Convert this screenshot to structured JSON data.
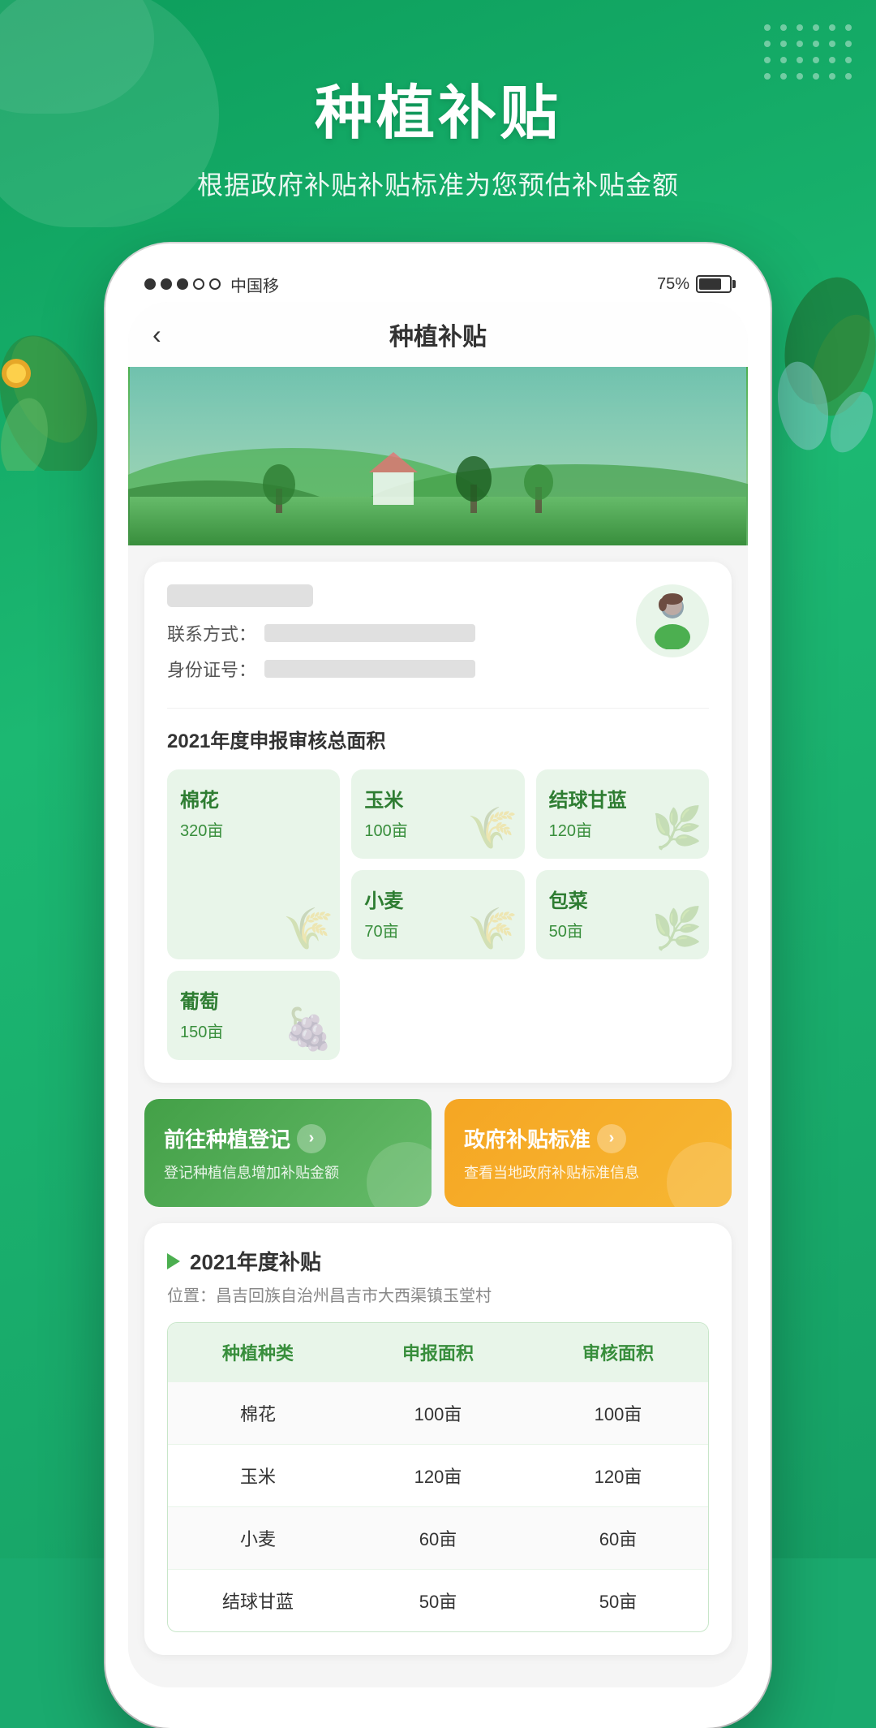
{
  "background": {
    "color": "#1aaa6e"
  },
  "header": {
    "title": "种植补贴",
    "subtitle": "根据政府补贴补贴标准为您预估补贴金额"
  },
  "statusBar": {
    "carrier": "中国移",
    "battery": "75%"
  },
  "navbar": {
    "back": "‹",
    "title": "种植补贴"
  },
  "userCard": {
    "nameBlurred": true,
    "contactLabel": "联系方式：",
    "idLabel": "身份证号："
  },
  "areaSection": {
    "title": "2021年度申报审核总面积",
    "crops": [
      {
        "name": "棉花",
        "area": "320亩",
        "large": true
      },
      {
        "name": "玉米",
        "area": "100亩",
        "large": false
      },
      {
        "name": "结球甘蓝",
        "area": "120亩",
        "large": false
      },
      {
        "name": "小麦",
        "area": "70亩",
        "large": false
      },
      {
        "name": "包菜",
        "area": "50亩",
        "large": false
      },
      {
        "name": "葡萄",
        "area": "150亩",
        "large": false
      }
    ]
  },
  "actionButtons": [
    {
      "title": "前往种植登记",
      "subtitle": "登记种植信息增加补贴金额",
      "type": "green",
      "arrow": "›"
    },
    {
      "title": "政府补贴标准",
      "subtitle": "查看当地政府补贴标准信息",
      "type": "orange",
      "arrow": "›"
    }
  ],
  "subsidySection": {
    "title": "2021年度补贴",
    "location": "位置：昌吉回族自治州昌吉市大西渠镇玉堂村",
    "tableHeaders": [
      "种植种类",
      "申报面积",
      "审核面积"
    ],
    "tableRows": [
      {
        "type": "棉花",
        "declared": "100亩",
        "approved": "100亩"
      },
      {
        "type": "玉米",
        "declared": "120亩",
        "approved": "120亩"
      },
      {
        "type": "小麦",
        "declared": "60亩",
        "approved": "60亩"
      },
      {
        "type": "结球甘蓝",
        "declared": "50亩",
        "approved": "50亩"
      }
    ]
  },
  "icons": {
    "leaf": "🌿",
    "wheat": "🌾",
    "grape": "🍇",
    "back_arrow": "‹",
    "circle_arrow": "›"
  },
  "dotGrid": {
    "rows": 4,
    "cols": 6
  }
}
